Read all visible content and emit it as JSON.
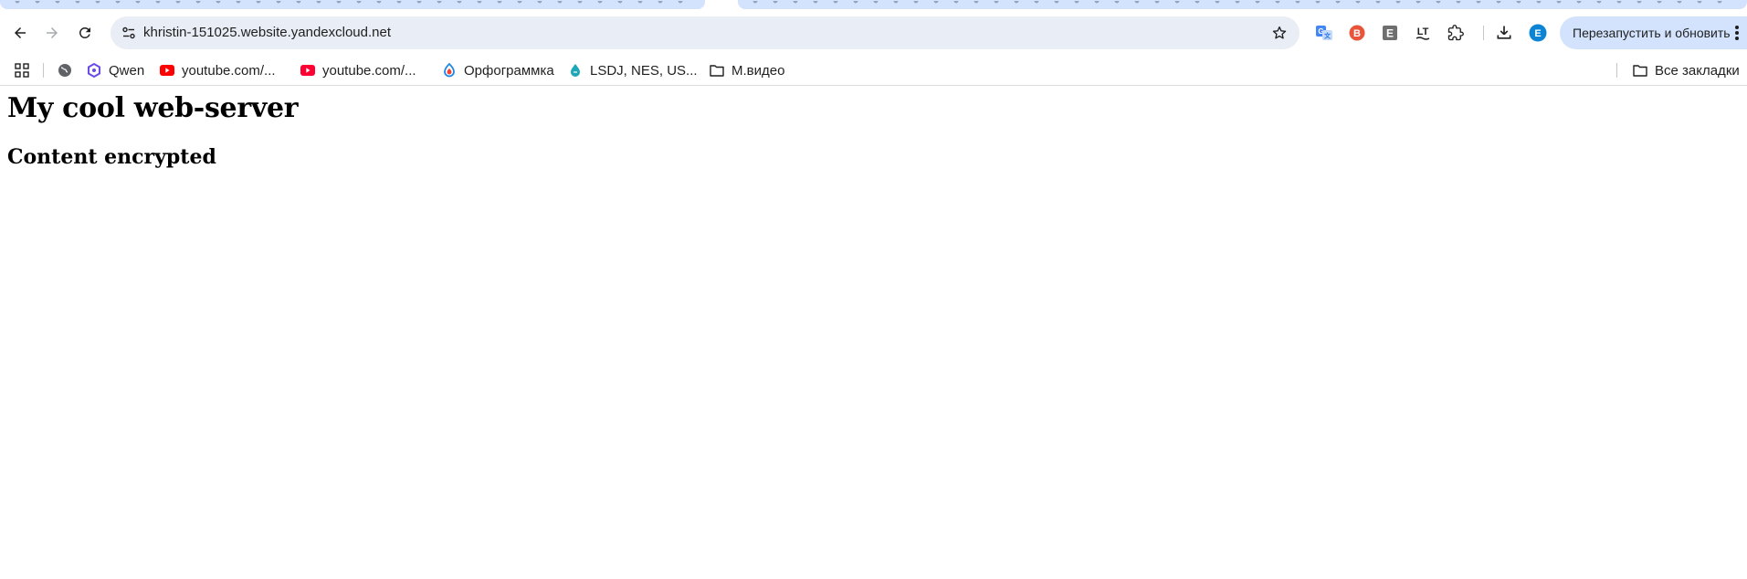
{
  "browser": {
    "address_bar": {
      "url": "khristin-151025.website.yandexcloud.net"
    },
    "relaunch_button": {
      "label": "Перезапустить и обновить"
    },
    "profile_avatar": {
      "letter": "E",
      "color": "#0b84d6"
    },
    "extensions": [
      {
        "icon": "translate-icon",
        "color": "#4285f4"
      },
      {
        "icon": "brave-style-icon",
        "color": "#e8553a"
      },
      {
        "icon": "e-letter-icon",
        "color": "#6f6f6f"
      },
      {
        "icon": "lt-icon",
        "color": "#1f1f1f"
      },
      {
        "icon": "puzzle-icon",
        "color": "#1f1f1f"
      }
    ]
  },
  "bookmarks": {
    "items": [
      {
        "label": "Qwen",
        "icon": "qwen-icon"
      },
      {
        "label": "youtube.com/...",
        "icon": "youtube-icon"
      },
      {
        "label": "youtube.com/...",
        "icon": "youtube-icon"
      },
      {
        "label": "Орфограммка",
        "icon": "orfogrammka-icon"
      },
      {
        "label": "LSDJ, NES, US...",
        "icon": "lsdj-icon"
      },
      {
        "label": "М.видео",
        "icon": "folder-icon"
      }
    ],
    "all_bookmarks": {
      "label": "Все закладки",
      "icon": "folder-icon"
    }
  },
  "page": {
    "title": "My cool web-server",
    "subtitle": "Content encrypted"
  }
}
